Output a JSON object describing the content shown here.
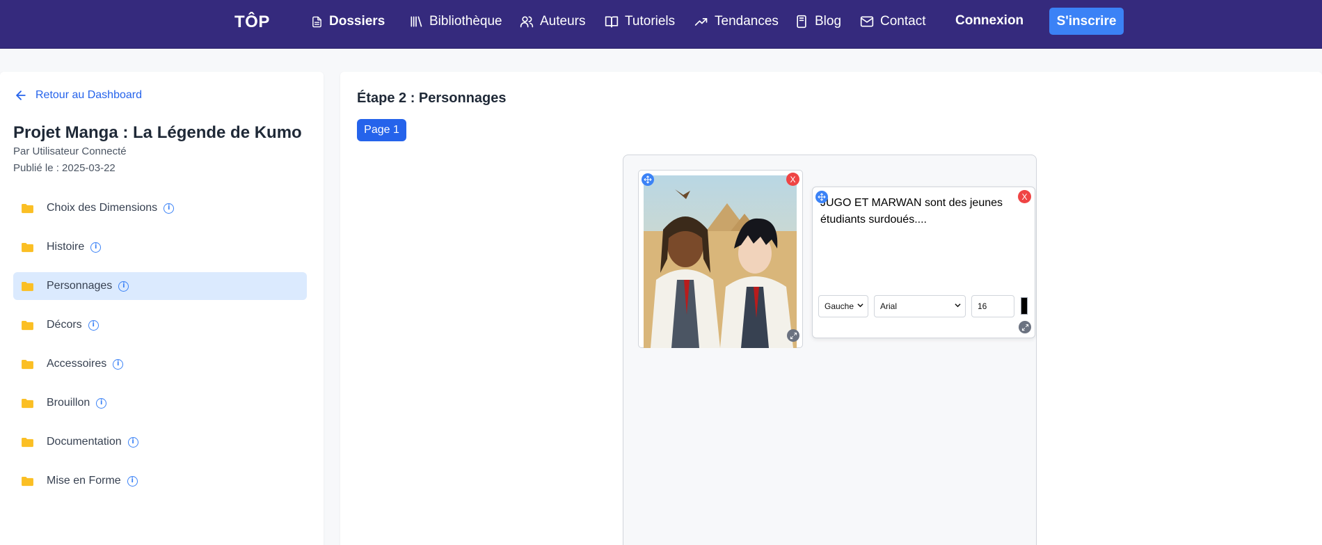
{
  "header": {
    "logo": "TÔP",
    "nav": [
      {
        "label": "Dossiers",
        "icon": "document-icon"
      },
      {
        "label": "Bibliothèque",
        "icon": "library-icon"
      },
      {
        "label": "Auteurs",
        "icon": "users-icon"
      },
      {
        "label": "Tutoriels",
        "icon": "book-open-icon"
      },
      {
        "label": "Tendances",
        "icon": "trending-up-icon"
      },
      {
        "label": "Blog",
        "icon": "notebook-icon"
      },
      {
        "label": "Contact",
        "icon": "mail-icon"
      }
    ],
    "login_label": "Connexion",
    "signup_label": "S'inscrire"
  },
  "sidebar": {
    "back_label": "Retour au Dashboard",
    "project_title": "Projet Manga : La Légende de Kumo",
    "author": "Par Utilisateur Connecté",
    "published": "Publié le : 2025-03-22",
    "folders": [
      {
        "label": "Choix des Dimensions",
        "active": false
      },
      {
        "label": "Histoire",
        "active": false
      },
      {
        "label": "Personnages",
        "active": true
      },
      {
        "label": "Décors",
        "active": false
      },
      {
        "label": "Accessoires",
        "active": false
      },
      {
        "label": "Brouillon",
        "active": false
      },
      {
        "label": "Documentation",
        "active": false
      },
      {
        "label": "Mise en Forme",
        "active": false
      }
    ]
  },
  "main": {
    "step_title": "Étape 2 : Personnages",
    "page_tab": "Page 1",
    "image_close": "X",
    "text_element": {
      "content": "JUGO ET MARWAN sont des jeunes étudiants surdoués....",
      "close": "X",
      "align_value": "Gauche",
      "font_value": "Arial",
      "size_value": "16",
      "text_color": "#000000"
    }
  },
  "colors": {
    "nav_bg": "#352a7d",
    "accent": "#2563eb",
    "signup_bg": "#3b82f6",
    "active_folder_bg": "#dbeafe",
    "folder_icon": "#fbbf24",
    "close_red": "#ef4444"
  }
}
